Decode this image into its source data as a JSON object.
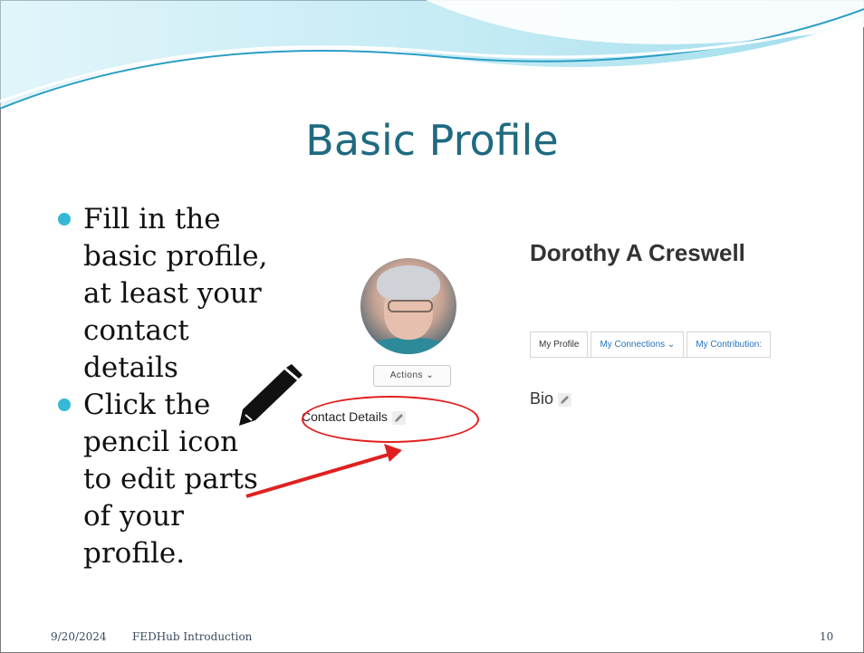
{
  "slide": {
    "title": "Basic Profile",
    "bullets": [
      "Fill in the basic profile, at least your contact details",
      "Click the pencil icon to edit parts of your profile."
    ],
    "bullet_lines": [
      [
        "Fill in the",
        "basic profile,",
        "at least your",
        "contact",
        "details"
      ],
      [
        "Click the",
        "pencil icon",
        "to edit parts",
        "of your",
        "profile."
      ]
    ]
  },
  "screenshot": {
    "profile_name": "Dorothy A Creswell",
    "actions_label": "Actions ⌄",
    "contact_details_label": "Contact Details",
    "tabs": [
      "My Profile",
      "My Connections ⌄",
      "My Contribution:"
    ],
    "bio_label": "Bio"
  },
  "footer": {
    "date": "9/20/2024",
    "title": "FEDHub Introduction",
    "page": "10"
  },
  "colors": {
    "title": "#1f6a80",
    "bullet": "#35b8d6",
    "annotation_red": "#e02020",
    "tab_link": "#2673b8"
  },
  "icons": [
    "pencil-icon",
    "edit-pencil-icon",
    "chevron-down-icon"
  ]
}
